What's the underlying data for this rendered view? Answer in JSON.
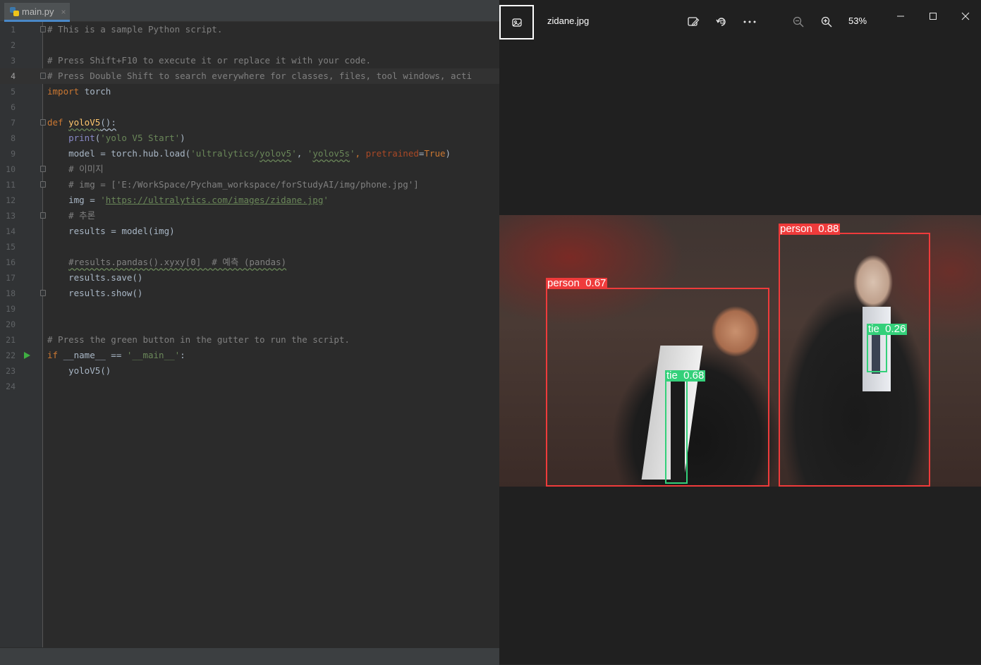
{
  "editor": {
    "tab": {
      "filename": "main.py",
      "close": "×"
    },
    "active_line": 4,
    "lines": [
      {
        "n": "1",
        "segs": [
          [
            "c-com",
            "# This is a sample Python script."
          ]
        ]
      },
      {
        "n": "2",
        "segs": []
      },
      {
        "n": "3",
        "segs": [
          [
            "c-com",
            "# Press Shift+F10 to execute it or replace it with your code."
          ]
        ]
      },
      {
        "n": "4",
        "segs": [
          [
            "c-com",
            "# Press Double Shift to search everywhere for classes, files, tool windows, acti"
          ]
        ]
      },
      {
        "n": "5",
        "segs": [
          [
            "c-kw",
            "import "
          ],
          [
            "",
            "torch"
          ]
        ]
      },
      {
        "n": "6",
        "segs": []
      },
      {
        "n": "7",
        "segs": [
          [
            "c-kw",
            "def "
          ],
          [
            "c-fn squig",
            "yoloV5"
          ],
          [
            "squig2",
            "():"
          ]
        ]
      },
      {
        "n": "8",
        "segs": [
          [
            "",
            "    "
          ],
          [
            "c-blt",
            "print"
          ],
          [
            "",
            "("
          ],
          [
            "c-str",
            "'yolo V5 Start'"
          ],
          [
            "",
            ")"
          ]
        ]
      },
      {
        "n": "9",
        "segs": [
          [
            "",
            "    model = torch.hub.load("
          ],
          [
            "c-str",
            "'ultralytics/"
          ],
          [
            "c-str squig",
            "yolov5"
          ],
          [
            "c-str",
            "'"
          ],
          [
            "",
            ", "
          ],
          [
            "c-str",
            "'"
          ],
          [
            "c-str squig",
            "yolov5s"
          ],
          [
            "c-str",
            "'"
          ],
          [
            "c-kw",
            ", "
          ],
          [
            "c-par",
            "pretrained"
          ],
          [
            "",
            "="
          ],
          [
            "c-kw",
            "True"
          ],
          [
            "",
            ")"
          ]
        ]
      },
      {
        "n": "10",
        "segs": [
          [
            "c-com",
            "    # 이미지"
          ]
        ]
      },
      {
        "n": "11",
        "segs": [
          [
            "c-com",
            "    # img = ['E:/WorkSpace/Pycham_workspace/forStudyAI/img/phone.jpg']"
          ]
        ]
      },
      {
        "n": "12",
        "segs": [
          [
            "",
            "    img = "
          ],
          [
            "c-str",
            "'"
          ],
          [
            "c-link2",
            "https://ultralytics.com/images/zidane.jpg"
          ],
          [
            "c-str",
            "'"
          ]
        ]
      },
      {
        "n": "13",
        "segs": [
          [
            "c-com",
            "    # 추론"
          ]
        ]
      },
      {
        "n": "14",
        "segs": [
          [
            "",
            "    results = model(img)"
          ]
        ]
      },
      {
        "n": "15",
        "segs": []
      },
      {
        "n": "16",
        "segs": [
          [
            "",
            "    "
          ],
          [
            "c-com squig",
            "#results.pandas().xyxy[0]  # 예측 (pandas)"
          ]
        ]
      },
      {
        "n": "17",
        "segs": [
          [
            "",
            "    results.save()"
          ]
        ]
      },
      {
        "n": "18",
        "segs": [
          [
            "",
            "    results.show()"
          ]
        ]
      },
      {
        "n": "19",
        "segs": []
      },
      {
        "n": "20",
        "segs": []
      },
      {
        "n": "21",
        "segs": [
          [
            "c-com",
            "# Press the green button in the gutter to run the script."
          ]
        ]
      },
      {
        "n": "22",
        "segs": [
          [
            "c-kw",
            "if "
          ],
          [
            "",
            "__name__ == "
          ],
          [
            "c-str",
            "'__main__'"
          ],
          [
            "",
            ":"
          ]
        ]
      },
      {
        "n": "23",
        "segs": [
          [
            "",
            "    yoloV5()"
          ]
        ]
      },
      {
        "n": "24",
        "segs": []
      }
    ],
    "fold_lines": [
      1,
      4,
      7,
      10,
      11,
      13,
      18
    ],
    "run_line": 22
  },
  "viewer": {
    "filename": "zidane.jpg",
    "zoom": "53%",
    "toolbar_icons": [
      "edit-image-icon",
      "rotate-icon",
      "more-options-icon",
      "zoom-out-icon",
      "zoom-in-icon"
    ],
    "window_controls": [
      "minimize-icon",
      "maximize-icon",
      "close-icon"
    ],
    "detections": [
      {
        "cls": "person",
        "label": "person  0.67"
      },
      {
        "cls": "person",
        "label": "person  0.88"
      },
      {
        "cls": "tie",
        "label": "tie  0.68"
      },
      {
        "cls": "tie",
        "label": "tie  0.26"
      }
    ],
    "colors": {
      "person": "#ef3b3b",
      "tie": "#34d07a"
    }
  }
}
